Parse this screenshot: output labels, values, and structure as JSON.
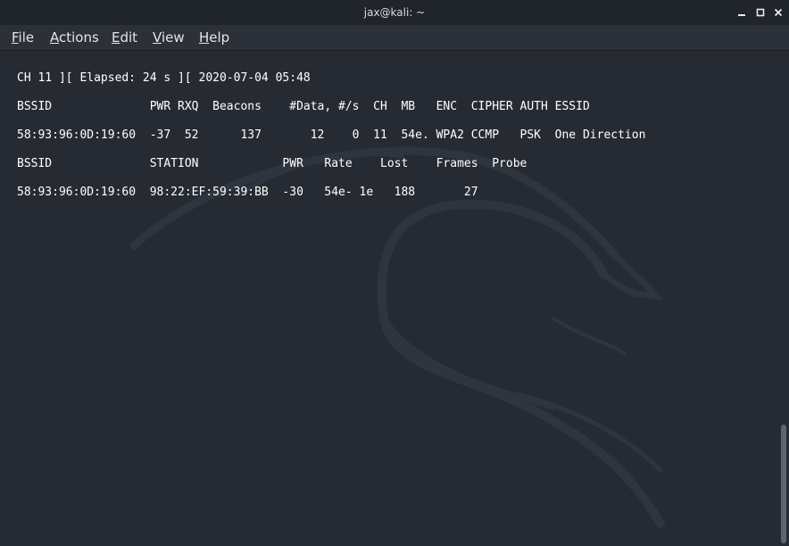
{
  "window": {
    "title": "jax@kali: ~"
  },
  "menu": {
    "items": [
      {
        "mnemonic": "F",
        "rest": "ile"
      },
      {
        "mnemonic": "A",
        "rest": "ctions"
      },
      {
        "mnemonic": "E",
        "rest": "dit"
      },
      {
        "mnemonic": "V",
        "rest": "iew"
      },
      {
        "mnemonic": "H",
        "rest": "elp"
      }
    ]
  },
  "terminal": {
    "lines": [
      "CH 11 ][ Elapsed: 24 s ][ 2020-07-04 05:48",
      "BSSID              PWR RXQ  Beacons    #Data, #/s  CH  MB   ENC  CIPHER AUTH ESSID",
      "58:93:96:0D:19:60  -37  52      137       12    0  11  54e. WPA2 CCMP   PSK  One Direction",
      "BSSID              STATION            PWR   Rate    Lost    Frames  Probe",
      "58:93:96:0D:19:60  98:22:EF:59:39:BB  -30   54e- 1e   188       27"
    ]
  },
  "colors": {
    "background": "#262b33",
    "titlebar": "#20242b",
    "menubar": "#2c3039",
    "text": "#ffffff",
    "watermark": "#2f353e"
  },
  "icons": {
    "minimize": "minimize-icon",
    "maximize": "maximize-icon",
    "close": "close-icon",
    "watermark": "kali-dragon-logo"
  }
}
